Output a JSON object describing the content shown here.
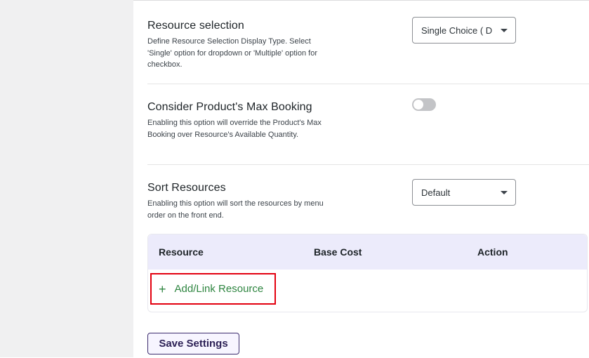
{
  "settings": {
    "resource_selection": {
      "title": "Resource selection",
      "description": "Define Resource Selection Display Type. Select 'Single' option for dropdown or 'Multiple' option for checkbox.",
      "select_value": "Single Choice ( D"
    },
    "max_booking": {
      "title": "Consider Product's Max Booking",
      "description": "Enabling this option will override the Product's Max Booking over Resource's Available Quantity.",
      "toggle_state": "off"
    },
    "sort_resources": {
      "title": "Sort Resources",
      "description": "Enabling this option will sort the resources by menu order on the front end.",
      "select_value": "Default"
    }
  },
  "resource_table": {
    "columns": [
      "Resource",
      "Base Cost",
      "Action"
    ],
    "add_link_label": "Add/Link Resource",
    "add_icon": "plus-icon"
  },
  "save_button_label": "Save Settings",
  "colors": {
    "table_header_bg": "#ecebfb",
    "add_link_green": "#2e8540",
    "highlight_red": "#e3000f",
    "toggle_off": "#c3c4c7"
  }
}
